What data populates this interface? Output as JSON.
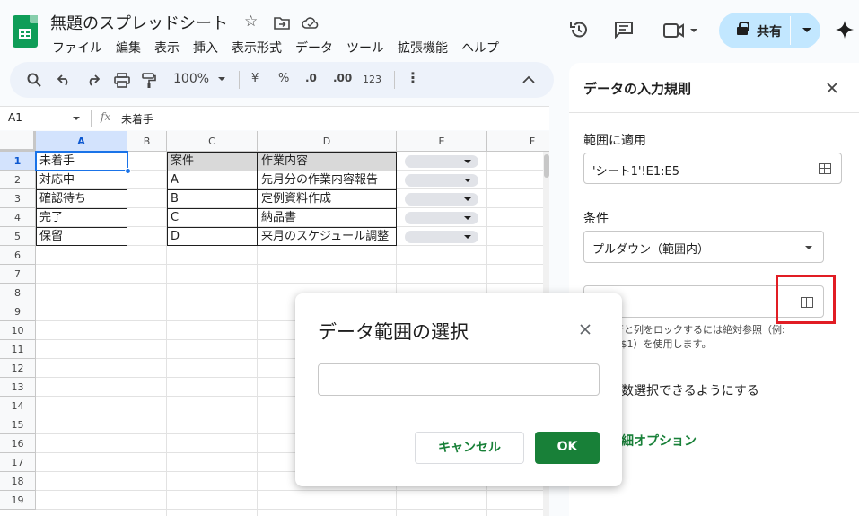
{
  "doc": {
    "title": "無題のスプレッドシート"
  },
  "menu": [
    "ファイル",
    "編集",
    "表示",
    "挿入",
    "表示形式",
    "データ",
    "ツール",
    "拡張機能",
    "ヘルプ"
  ],
  "header": {
    "share_label": "共有"
  },
  "toolbar": {
    "zoom": "100%",
    "currency": "¥",
    "percent": "%",
    "dec_minus": ".0",
    "dec_plus": ".00",
    "number_format": "123"
  },
  "formula": {
    "name_box": "A1",
    "fx": "fx",
    "value": "未着手"
  },
  "grid": {
    "columns": [
      "A",
      "B",
      "C",
      "D",
      "E",
      "F"
    ],
    "rows": [
      "1",
      "2",
      "3",
      "4",
      "5",
      "6",
      "7",
      "8",
      "9",
      "10",
      "11",
      "12",
      "13",
      "14",
      "15",
      "16",
      "17",
      "18",
      "19"
    ],
    "colA": [
      "未着手",
      "対応中",
      "確認待ち",
      "完了",
      "保留"
    ],
    "table_header": [
      "案件",
      "作業内容"
    ],
    "table_cases": [
      "A",
      "B",
      "C",
      "D"
    ],
    "table_work": [
      "先月分の作業内容報告",
      "定例資料作成",
      "納品書",
      "来月のスケジュール調整"
    ]
  },
  "panel": {
    "title": "データの入力規則",
    "apply_label": "範囲に適用",
    "apply_value": "'シート1'!E1:E5",
    "condition_label": "条件",
    "condition_value": "プルダウン（範囲内）",
    "hint_line1": "行と列をロックするには絶対参照（例:",
    "hint_line2": "B$1）を使用します。",
    "multi_select": "数選択できるようにする",
    "advanced": "細オプション"
  },
  "dialog": {
    "title": "データ範囲の選択",
    "input_value": "",
    "cancel_label": "キャンセル",
    "ok_label": "OK"
  },
  "colors": {
    "accent_green": "#188038",
    "share_bg": "#c2e7ff",
    "highlight": "#e11d24"
  }
}
